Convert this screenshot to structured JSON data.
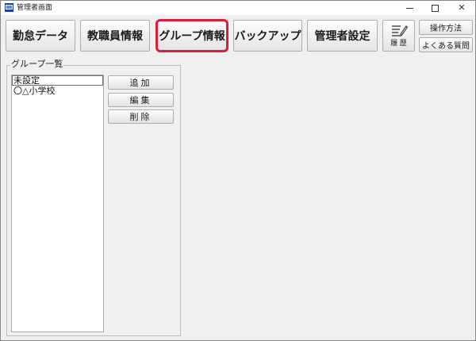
{
  "window": {
    "title": "管理者画面",
    "controls": {
      "minimize": "",
      "maximize": "",
      "close": "✕"
    }
  },
  "toolbar": {
    "items": [
      {
        "label": "勤怠データ"
      },
      {
        "label": "教職員情報"
      },
      {
        "label": "グループ情報",
        "active": true
      },
      {
        "label": "バックアップ"
      },
      {
        "label": "管理者設定"
      }
    ],
    "history": {
      "label": "履 歴",
      "icon": "notepad-pen-icon"
    },
    "help": {
      "label": "操作方法"
    },
    "faq": {
      "label": "よくある質問"
    }
  },
  "colors": {
    "active_outline": "#d81e3c",
    "panel_background": "#f0f0f0"
  },
  "group_panel": {
    "legend": "グループ一覧",
    "list": [
      {
        "label": "未設定",
        "selected": true
      },
      {
        "label": "〇△小学校"
      }
    ],
    "buttons": {
      "add": "追加",
      "edit": "編集",
      "delete": "削除"
    }
  }
}
